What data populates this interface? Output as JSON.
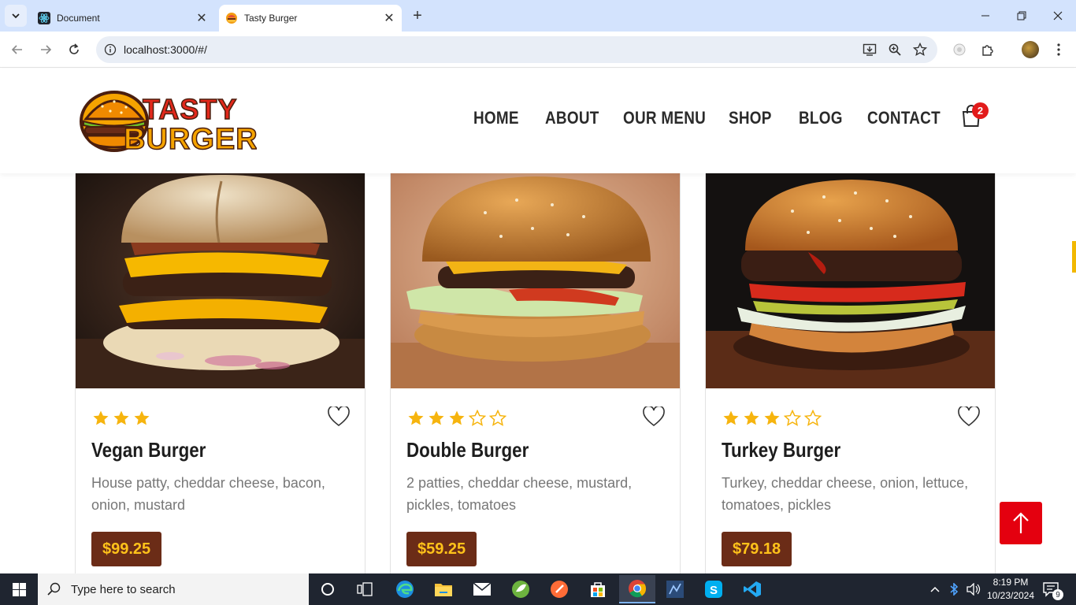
{
  "browser": {
    "tabs": [
      {
        "title": "Document",
        "active": false
      },
      {
        "title": "Tasty Burger",
        "active": true
      }
    ],
    "url": "localhost:3000/#/"
  },
  "site": {
    "logo": {
      "line1": "TASTY",
      "line2": "BURGER"
    },
    "nav": [
      "HOME",
      "ABOUT",
      "OUR MENU",
      "SHOP",
      "BLOG",
      "CONTACT"
    ],
    "cart_count": "2"
  },
  "products": [
    {
      "name": "Vegan Burger",
      "description": "House patty, cheddar cheese, bacon, onion, mustard",
      "price": "$99.25",
      "rating": 3,
      "max_rating": 3
    },
    {
      "name": "Double Burger",
      "description": "2 patties, cheddar cheese, mustard, pickles, tomatoes",
      "price": "$59.25",
      "rating": 3,
      "max_rating": 5
    },
    {
      "name": "Turkey Burger",
      "description": "Turkey, cheddar cheese, onion, lettuce, tomatoes, pickles",
      "price": "$79.18",
      "rating": 3,
      "max_rating": 5
    }
  ],
  "taskbar": {
    "search_placeholder": "Type here to search",
    "time": "8:19 PM",
    "date": "10/23/2024",
    "notifications": "9"
  },
  "colors": {
    "price_bg": "#6b2c17",
    "price_text": "#ffc21a",
    "star": "#f6b40e",
    "scroll_top_bg": "#e4000f",
    "cart_badge": "#e21b1b"
  }
}
